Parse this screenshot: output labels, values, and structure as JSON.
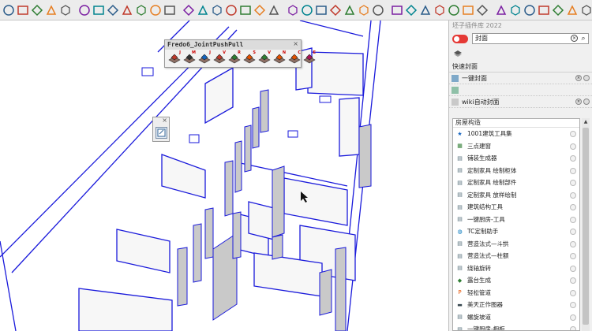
{
  "toolbar": {
    "icons": [
      "select-icon",
      "circle-tool-icon",
      "sun-icon",
      "teapot-icon",
      "orbit-icon",
      "zoom-icon",
      "zoom-extents-icon",
      "prev-view-icon",
      "section-icon",
      "display-icon",
      "wireframe-icon",
      "material-icon",
      "gear-icon",
      "move-icon",
      "measure-icon",
      "rotate-icon",
      "section-plane-icon",
      "axis-icon",
      "text-icon",
      "dimension-icon",
      "iso-view-icon",
      "top-view-icon",
      "front-view-icon",
      "right-view-icon",
      "back-view-icon",
      "left-view-icon",
      "xray-icon",
      "hidden-line-icon",
      "shaded-icon",
      "textured-icon",
      "monochrome-icon",
      "grid-icon",
      "component-icon",
      "layer-icon",
      "scene-icon",
      "shadow-icon",
      "fog-icon",
      "edge-icon",
      "cube-icon",
      "cube-icon-2",
      "cube-icon-3"
    ]
  },
  "floating_toolbar": {
    "title": "Fredo6_JointPushPull",
    "close": "×",
    "letters": [
      "J",
      "M",
      "J",
      "V",
      "R",
      "S",
      "V",
      "N",
      "C",
      "E"
    ]
  },
  "mini_toolbar": {
    "close": "×"
  },
  "panel": {
    "title": "坯子插件库 2022",
    "search_value": "封面",
    "search_clear": "×",
    "search_go": "⌕",
    "quick_label": "快速封面",
    "pinned": [
      {
        "label": "一键封面"
      },
      {
        "label": "wiki自动封面"
      }
    ],
    "list_header": "房屋构造",
    "items": [
      {
        "label": "1001建筑工具集",
        "icon": "★",
        "color": "#1565c0"
      },
      {
        "label": "三点建窗",
        "icon": "▦",
        "color": "#2e7d32"
      },
      {
        "label": "铺装生成器",
        "icon": "▤",
        "color": "#546e7a"
      },
      {
        "label": "定制家具 绘制柜体",
        "icon": "▤",
        "color": "#546e7a"
      },
      {
        "label": "定制家具 绘制部件",
        "icon": "▤",
        "color": "#546e7a"
      },
      {
        "label": "定制家具 放样绘制",
        "icon": "▤",
        "color": "#546e7a"
      },
      {
        "label": "建筑结构工具",
        "icon": "▤",
        "color": "#546e7a"
      },
      {
        "label": "一键厨房-工具",
        "icon": "▤",
        "color": "#546e7a"
      },
      {
        "label": "TC定制助手",
        "icon": "◍",
        "color": "#0277bd"
      },
      {
        "label": "营造法式—斗拱",
        "icon": "▤",
        "color": "#546e7a"
      },
      {
        "label": "营造法式—柱额",
        "icon": "▤",
        "color": "#546e7a"
      },
      {
        "label": "绕轴旋转",
        "icon": "▤",
        "color": "#546e7a"
      },
      {
        "label": "露台生成",
        "icon": "◆",
        "color": "#2e7d32"
      },
      {
        "label": "轻松管道",
        "icon": "P",
        "color": "#e65100"
      },
      {
        "label": "美天正作图器",
        "icon": "▬",
        "color": "#37474f"
      },
      {
        "label": "螺旋坡道",
        "icon": "▤",
        "color": "#546e7a"
      },
      {
        "label": "一键厨房-橱柜",
        "icon": "▤",
        "color": "#546e7a"
      }
    ]
  }
}
